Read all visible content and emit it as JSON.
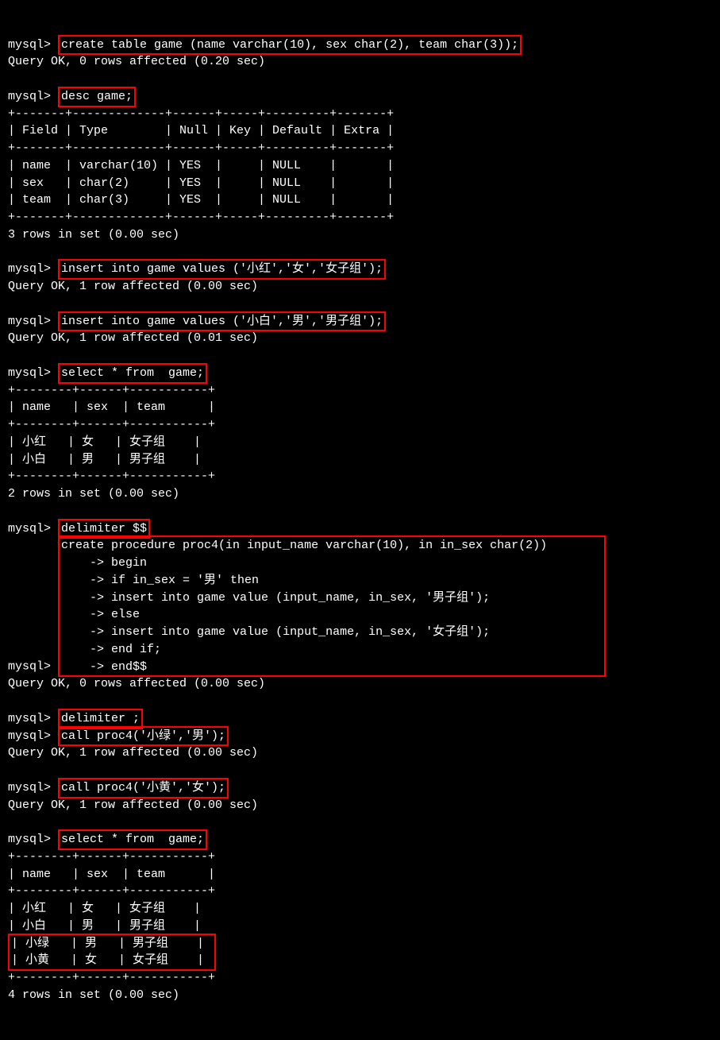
{
  "lines": {
    "l1_prompt": "mysql> ",
    "l1_cmd": "create table game (name varchar(10), sex char(2), team char(3));",
    "l2": "Query OK, 0 rows affected (0.20 sec)",
    "l3_prompt": "mysql> ",
    "l3_cmd": "desc game;",
    "desc_border": "+-------+-------------+------+-----+---------+-------+",
    "desc_header": "| Field | Type        | Null | Key | Default | Extra |",
    "desc_row1": "| name  | varchar(10) | YES  |     | NULL    |       |",
    "desc_row2": "| sex   | char(2)     | YES  |     | NULL    |       |",
    "desc_row3": "| team  | char(3)     | YES  |     | NULL    |       |",
    "desc_footer": "3 rows in set (0.00 sec)",
    "l4_prompt": "mysql> ",
    "l4_cmd": "insert into game values ('小红','女','女子组');",
    "l4_res": "Query OK, 1 row affected (0.00 sec)",
    "l5_prompt": "mysql> ",
    "l5_cmd": "insert into game values ('小白','男','男子组');",
    "l5_res": "Query OK, 1 row affected (0.01 sec)",
    "l6_prompt": "mysql> ",
    "l6_cmd": "select * from  game;",
    "sel1_border": "+--------+------+-----------+",
    "sel1_header": "| name   | sex  | team      |",
    "sel1_row1": "| 小红   | 女   | 女子组    |",
    "sel1_row2": "| 小白   | 男   | 男子组    |",
    "sel1_footer": "2 rows in set (0.00 sec)",
    "l7_prompt": "mysql> ",
    "l7_cmd": "delimiter $$",
    "l8_prompt": "mysql> ",
    "l8_cmd": "create procedure proc4(in input_name varchar(10), in in_sex char(2))",
    "cont": "    -> ",
    "p1": "begin",
    "p2": "if in_sex = '男' then",
    "p3": "insert into game value (input_name, in_sex, '男子组');",
    "p4": "else",
    "p5": "insert into game value (input_name, in_sex, '女子组');",
    "p6": "end if;",
    "p7": "end$$",
    "proc_res": "Query OK, 0 rows affected (0.00 sec)",
    "l9_prompt": "mysql> ",
    "l9_cmd": "delimiter ;",
    "l10_prompt": "mysql> ",
    "l10_cmd": "call proc4('小绿','男');",
    "l10_res": "Query OK, 1 row affected (0.00 sec)",
    "l11_prompt": "mysql> ",
    "l11_cmd": "call proc4('小黄','女');",
    "l11_res": "Query OK, 1 row affected (0.00 sec)",
    "l12_prompt": "mysql> ",
    "l12_cmd": "select * from  game;",
    "sel2_border": "+--------+------+-----------+",
    "sel2_header": "| name   | sex  | team      |",
    "sel2_row1": "| 小红   | 女   | 女子组    |",
    "sel2_row2": "| 小白   | 男   | 男子组    |",
    "sel2_row3": "| 小绿   | 男   | 男子组    |",
    "sel2_row4": "| 小黄   | 女   | 女子组    |",
    "sel2_footer": "4 rows in set (0.00 sec)"
  }
}
